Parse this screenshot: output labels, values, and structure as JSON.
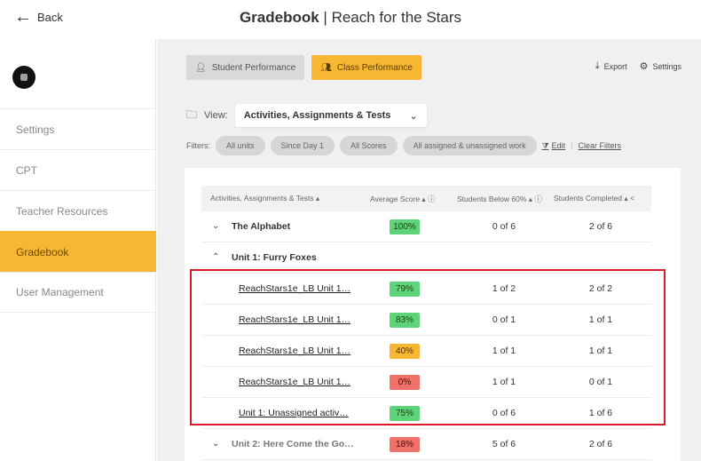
{
  "topbar": {
    "back_label": "Back",
    "title_bold": "Gradebook",
    "title_rest": " | Reach for the Stars"
  },
  "sidebar": {
    "items": [
      {
        "label": "Settings"
      },
      {
        "label": "CPT"
      },
      {
        "label": "Teacher Resources"
      },
      {
        "label": "Gradebook"
      },
      {
        "label": "User Management"
      }
    ],
    "active_index": 3
  },
  "tabs": {
    "student": "Student Performance",
    "class": "Class Performance"
  },
  "actions": {
    "export": "Export",
    "settings": "Settings"
  },
  "view": {
    "label": "View:",
    "selected": "Activities, Assignments & Tests"
  },
  "filters": {
    "label": "Filters:",
    "chips": [
      "All units",
      "Since Day 1",
      "All Scores",
      "All assigned & unassigned work"
    ],
    "edit": "Edit",
    "clear": "Clear Filters"
  },
  "table": {
    "headers": {
      "name": "Activities, Assignments & Tests ▴",
      "avg": "Average Score ▴ ⓘ",
      "below": "Students Below 60% ▴ ⓘ",
      "completed": "Students Completed ▴ ˂"
    },
    "groups": [
      {
        "name": "The Alphabet",
        "avg": "100%",
        "below": "0 of 6",
        "completed": "2 of 6",
        "expanded": false
      },
      {
        "name": "Unit 1: Furry Foxes",
        "expanded": true
      },
      {
        "name": "Unit 2: Here Come the Go…",
        "avg": "18%",
        "below": "5 of 6",
        "completed": "2 of 6",
        "expanded": false
      }
    ],
    "rows": [
      {
        "name": "ReachStars1e_LB Unit 1…",
        "avg": "79%",
        "avg_status": "green",
        "below": "1 of 2",
        "completed": "2 of 2"
      },
      {
        "name": "ReachStars1e_LB Unit 1…",
        "avg": "83%",
        "avg_status": "green",
        "below": "0 of 1",
        "completed": "1 of 1"
      },
      {
        "name": "ReachStars1e_LB Unit 1…",
        "avg": "40%",
        "avg_status": "orange",
        "below": "1 of 1",
        "completed": "1 of 1"
      },
      {
        "name": "ReachStars1e_LB Unit 1…",
        "avg": "0%",
        "avg_status": "red",
        "below": "1 of 1",
        "completed": "0 of 1"
      },
      {
        "name": "Unit 1: Unassigned activ…",
        "avg": "75%",
        "avg_status": "green",
        "below": "0 of 6",
        "completed": "1 of 6"
      }
    ]
  },
  "colors": {
    "accent": "#f7b733",
    "green": "#5fd37a",
    "orange": "#f7b733",
    "red": "#f0706a",
    "highlight_border": "#d91a2a"
  }
}
